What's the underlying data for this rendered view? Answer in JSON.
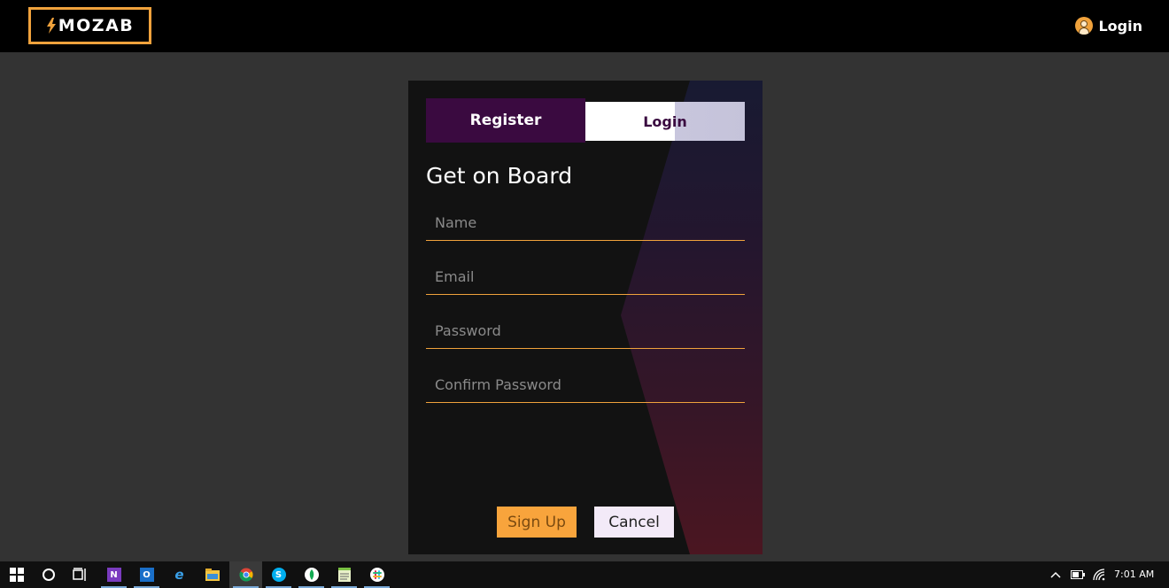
{
  "brand": {
    "name": "MOZAB",
    "accent": "#f0a23c"
  },
  "nav": {
    "login_label": "Login"
  },
  "tabs": {
    "register_label": "Register",
    "login_label": "Login"
  },
  "form": {
    "title": "Get on Board",
    "name_placeholder": "Name",
    "email_placeholder": "Email",
    "password_placeholder": "Password",
    "confirm_password_placeholder": "Confirm Password",
    "signup_label": "Sign Up",
    "cancel_label": "Cancel"
  },
  "taskbar": {
    "items": [
      "windows-start",
      "cortana-search",
      "task-view",
      "onenote",
      "outlook",
      "internet-explorer",
      "file-explorer",
      "chrome",
      "skype",
      "mongodb-compass",
      "notepad",
      "slack"
    ],
    "tray_icons": [
      "show-hidden-icons",
      "battery",
      "wifi"
    ],
    "clock": "7:01 AM"
  }
}
